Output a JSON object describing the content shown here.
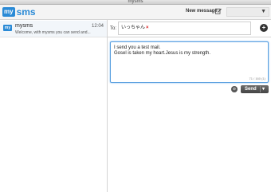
{
  "window": {
    "title": "mysms"
  },
  "header": {
    "logo_badge": "my",
    "logo_word": "sms",
    "new_message_label": "New message",
    "account_caret": "▼"
  },
  "conversations": [
    {
      "avatar": "my",
      "name": "mysms",
      "time": "12:04",
      "preview": "Welcome, with mysms you can send and..."
    }
  ],
  "compose": {
    "to_label": "To:",
    "recipient": "いっちゃん",
    "remove_symbol": "×",
    "add_symbol": "+",
    "message_lines": [
      "I send you a test mail.",
      "Gosel is taken my heart.Jesus is my strength."
    ],
    "counter": "71 / 160 (1)",
    "send_label": "Send",
    "send_caret": "▾",
    "attach_symbol": "⊘"
  },
  "colors": {
    "accent": "#2a8ad6",
    "focus_border": "#5aa0e0"
  }
}
